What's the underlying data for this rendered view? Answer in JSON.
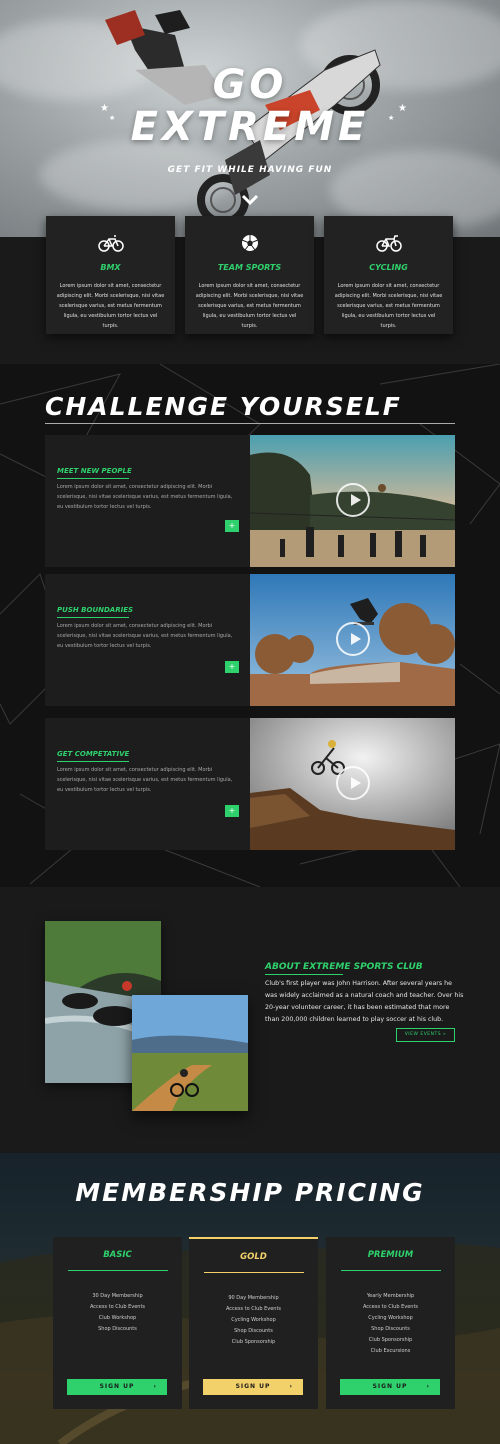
{
  "hero": {
    "title_line1": "GO",
    "title_line2": "EXTREME",
    "subtitle": "GET FIT WHILE HAVING FUN"
  },
  "features": [
    {
      "title": "BMX",
      "icon": "bicycle-icon",
      "text": "Lorem ipsum dolor sit amet, consectetur adipiscing elit. Morbi scelerisque, nisi vitae scelerisque varius, est metus fermentum ligula, eu vestibulum tortor lectus vel turpis."
    },
    {
      "title": "TEAM SPORTS",
      "icon": "soccer-ball-icon",
      "text": "Lorem ipsum dolor sit amet, consectetur adipiscing elit. Morbi scelerisque, nisi vitae scelerisque varius, est metus fermentum ligula, eu vestibulum tortor lectus vel turpis."
    },
    {
      "title": "CYCLING",
      "icon": "bicycle-icon",
      "text": "Lorem ipsum dolor sit amet, consectetur adipiscing elit. Morbi scelerisque, nisi vitae scelerisque varius, est metus fermentum ligula, eu vestibulum tortor lectus vel turpis."
    }
  ],
  "challenge": {
    "title": "CHALLENGE YOURSELF",
    "rows": [
      {
        "label": "MEET NEW PEOPLE",
        "text": "Lorem ipsum dolor sit amet, consectetur adipiscing elit. Morbi scelerisque, nisi vitae scelerisque varius, est metus fermentum ligula, eu vestibulum tortor lectus vel turpis.",
        "button": "+"
      },
      {
        "label": "PUSH BOUNDARIES",
        "text": "Lorem ipsum dolor sit amet, consectetur adipiscing elit. Morbi scelerisque, nisi vitae scelerisque varius, est metus fermentum ligula, eu vestibulum tortor lectus vel turpis.",
        "button": "+"
      },
      {
        "label": "GET COMPETATIVE",
        "text": "Lorem ipsum dolor sit amet, consectetur adipiscing elit. Morbi scelerisque, nisi vitae scelerisque varius, est metus fermentum ligula, eu vestibulum tortor lectus vel turpis.",
        "button": "+"
      }
    ]
  },
  "about": {
    "heading": "ABOUT EXTREME SPORTS CLUB",
    "text": "Club's first player was John Harrison. After several years he was widely acclaimed as a natural coach and teacher. Over his 20-year volunteer career, it has been estimated that more than 200,000 children learned to play soccer at his club.",
    "button": "VIEW EVENTS »"
  },
  "pricing": {
    "title": "MEMBERSHIP PRICING",
    "plans": [
      {
        "name": "BASIC",
        "color": "#2fd16d",
        "features": [
          "30 Day Membership",
          "Access to Club Events",
          "Club Workshop",
          "Shop Discounts"
        ],
        "button": "SIGN UP",
        "arrow": "›"
      },
      {
        "name": "GOLD",
        "color": "#f2d16b",
        "features": [
          "90 Day Membership",
          "Access to Club Events",
          "Cycling Workshop",
          "Shop Discounts",
          "Club Sponsorship"
        ],
        "button": "SIGN UP",
        "arrow": "›"
      },
      {
        "name": "PREMIUM",
        "color": "#2fd16d",
        "features": [
          "Yearly Membership",
          "Access to Club Events",
          "Cycling Workshop",
          "Shop Discounts",
          "Club Sponsorship",
          "Club Excursions"
        ],
        "button": "SIGN UP",
        "arrow": "›"
      }
    ]
  }
}
